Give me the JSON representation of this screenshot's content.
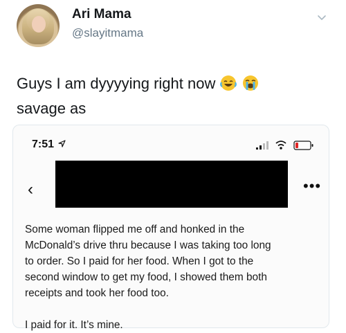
{
  "tweet": {
    "display_name": "Ari Mama",
    "handle": "@slayitmama",
    "text_line1": "Guys I am dyyyying right now",
    "text_line2": "savage as",
    "emojis": [
      "face-with-tears-of-joy-icon",
      "loudly-crying-face-icon"
    ]
  },
  "screenshot": {
    "status_time": "7:51",
    "message_paragraph1_lines": [
      "Some woman flipped me off and honked in the",
      "McDonald’s drive thru because I was taking too long",
      "to order. So I paid for her food. When I got to the",
      "second window to get my food, I showed them both",
      "receipts and took her food too."
    ],
    "message_paragraph2": "I paid for it. It’s mine."
  }
}
